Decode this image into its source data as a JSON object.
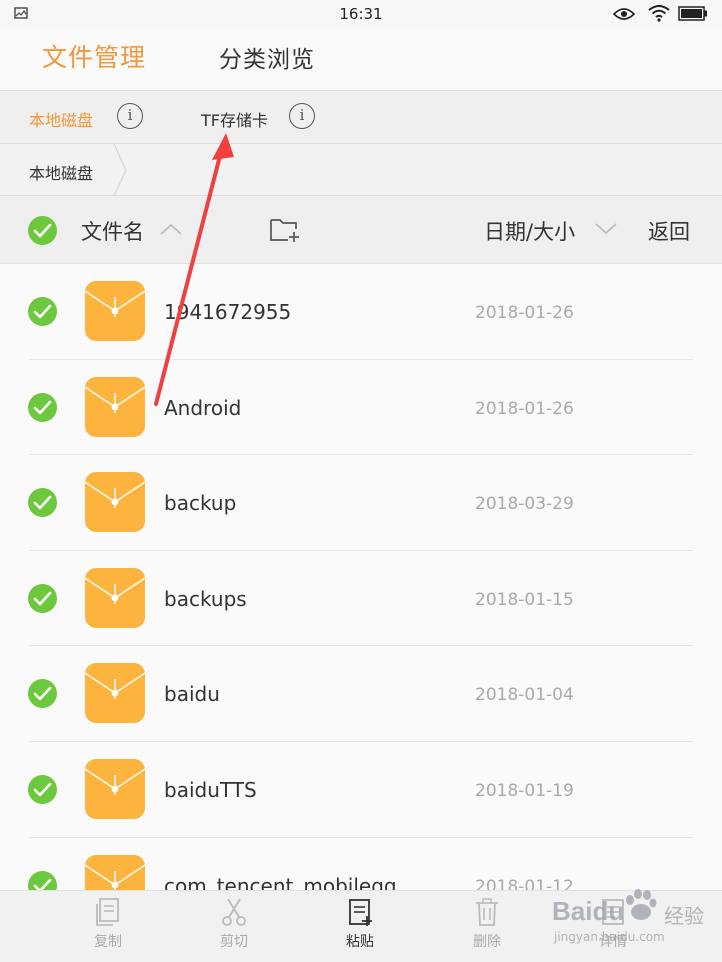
{
  "status_bar": {
    "time": "16:31"
  },
  "header": {
    "tabs": [
      {
        "label": "文件管理"
      },
      {
        "label": "分类浏览"
      }
    ]
  },
  "storage": {
    "local": "本地磁盘",
    "tf": "TF存储卡"
  },
  "breadcrumb": {
    "items": [
      "本地磁盘"
    ]
  },
  "list_header": {
    "name_label": "文件名",
    "date_label": "日期/大小",
    "back_label": "返回"
  },
  "files": [
    {
      "name": "1941672955",
      "date": "2018-01-26"
    },
    {
      "name": "Android",
      "date": "2018-01-26"
    },
    {
      "name": "backup",
      "date": "2018-03-29"
    },
    {
      "name": "backups",
      "date": "2018-01-15"
    },
    {
      "name": "baidu",
      "date": "2018-01-04"
    },
    {
      "name": "baiduTTS",
      "date": "2018-01-19"
    },
    {
      "name": "com_tencent_mobileqq",
      "date": "2018-01-12"
    }
  ],
  "toolbar": {
    "copy": "复制",
    "cut": "剪切",
    "paste": "粘贴",
    "delete": "删除",
    "details": "详情"
  },
  "watermark": {
    "brand": "Baidu",
    "jingyan": "经验",
    "url": "jingyan.baidu.com"
  },
  "colors": {
    "accent": "#f2973a",
    "check": "#6cc83c",
    "folder": "#fdb43e",
    "arrow": "#f04040"
  }
}
